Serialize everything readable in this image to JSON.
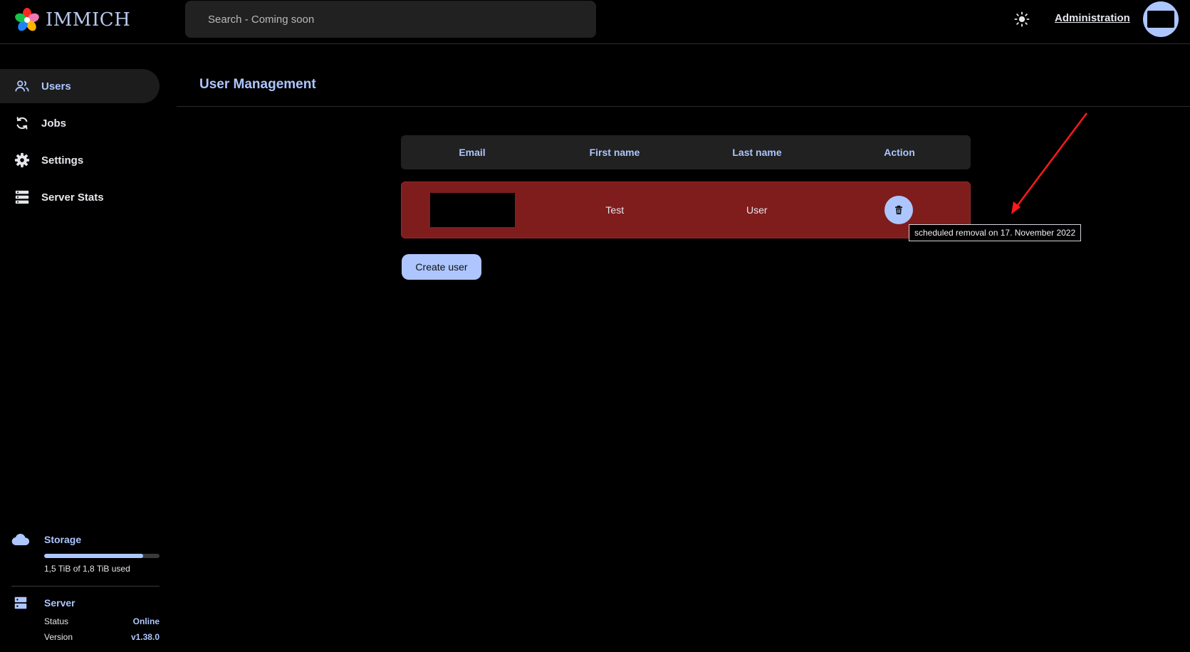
{
  "app": {
    "logo_text": "IMMICH"
  },
  "header": {
    "search_placeholder": "Search - Coming soon",
    "admin_link": "Administration"
  },
  "sidebar": {
    "items": [
      {
        "label": "Users",
        "icon": "users-icon",
        "active": true
      },
      {
        "label": "Jobs",
        "icon": "sync-icon"
      },
      {
        "label": "Settings",
        "icon": "gear-icon"
      },
      {
        "label": "Server Stats",
        "icon": "server-icon"
      }
    ],
    "storage": {
      "title": "Storage",
      "usage_text": "1,5 TiB of 1,8 TiB used",
      "used_fraction": 0.86
    },
    "server": {
      "title": "Server",
      "status_label": "Status",
      "status_value": "Online",
      "version_label": "Version",
      "version_value": "v1.38.0"
    }
  },
  "main": {
    "title": "User Management",
    "table": {
      "headers": [
        "Email",
        "First name",
        "Last name",
        "Action"
      ],
      "rows": [
        {
          "email": "",
          "first_name": "Test",
          "last_name": "User"
        }
      ]
    },
    "tooltip": "scheduled removal on 17. November 2022",
    "create_button": "Create user"
  },
  "colors": {
    "accent": "#adc6ff",
    "row_pending_delete": "#7f1d1d",
    "background": "#000000",
    "surface": "#212121",
    "annotation_arrow": "#ff1a1a"
  }
}
